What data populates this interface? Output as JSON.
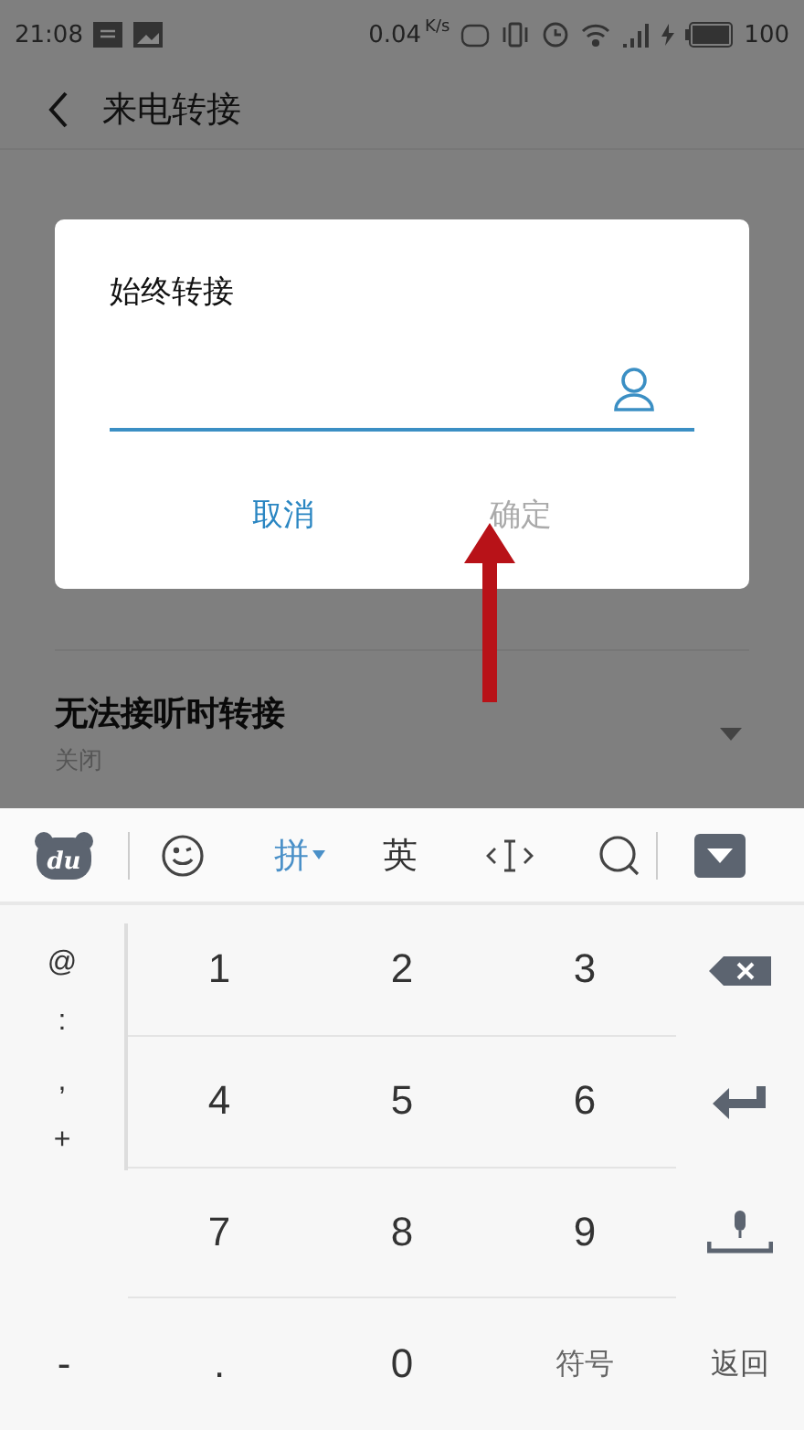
{
  "status_bar": {
    "time": "21:08",
    "speed": "0.04",
    "speed_unit": "K/s",
    "battery": "100"
  },
  "header": {
    "title": "来电转接"
  },
  "settings": [
    {
      "title": "无法接听时转接",
      "subtitle": "关闭",
      "dropdown": true
    }
  ],
  "dialog": {
    "title": "始终转接",
    "buttons": [
      {
        "label": "取消",
        "disabled": false
      },
      {
        "label": "确定",
        "disabled": true
      }
    ]
  },
  "keyboard": {
    "toolbar": [
      {
        "kind": "logo",
        "label": "du"
      },
      {
        "kind": "emoji"
      },
      {
        "kind": "mode",
        "label": "拼",
        "selected": true
      },
      {
        "kind": "mode",
        "label": "英",
        "selected": false
      },
      {
        "kind": "cursor"
      },
      {
        "kind": "search"
      },
      {
        "kind": "hide"
      }
    ],
    "symbols": [
      "@",
      ":",
      ",",
      "+"
    ],
    "keys": [
      "1",
      "2",
      "3",
      "4",
      "5",
      "6",
      "7",
      "8",
      "9"
    ],
    "bottom": {
      "symbol": "-",
      "dot": ".",
      "zero": "0",
      "symbols_key": "符号",
      "back_key": "返回"
    }
  }
}
